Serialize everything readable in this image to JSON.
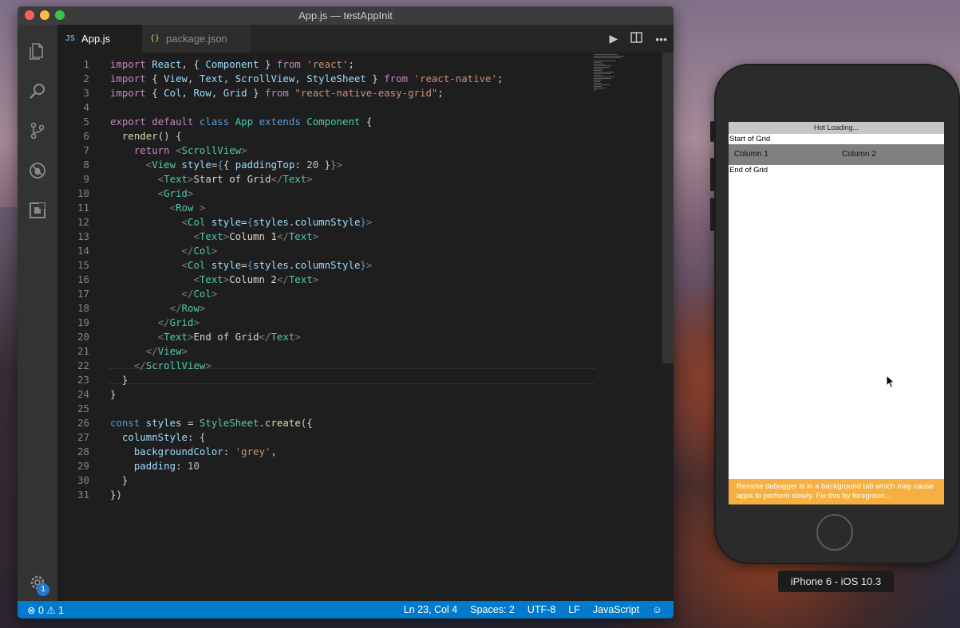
{
  "window": {
    "title": "App.js — testAppInit"
  },
  "tabs": [
    {
      "icon": "JS",
      "label": "App.js",
      "active": true,
      "close": "×"
    },
    {
      "icon": "{}",
      "label": "package.json",
      "active": false
    }
  ],
  "code_lines": [
    {
      "n": "1",
      "tokens": [
        [
          "k",
          "import"
        ],
        [
          "p",
          " "
        ],
        [
          "v",
          "React"
        ],
        [
          "p",
          ", { "
        ],
        [
          "v",
          "Component"
        ],
        [
          "p",
          " } "
        ],
        [
          "k",
          "from"
        ],
        [
          "p",
          " "
        ],
        [
          "s",
          "'react'"
        ],
        [
          "p",
          ";"
        ]
      ]
    },
    {
      "n": "2",
      "tokens": [
        [
          "k",
          "import"
        ],
        [
          "p",
          " { "
        ],
        [
          "v",
          "View"
        ],
        [
          "p",
          ", "
        ],
        [
          "v",
          "Text"
        ],
        [
          "p",
          ", "
        ],
        [
          "v",
          "ScrollView"
        ],
        [
          "p",
          ", "
        ],
        [
          "v",
          "StyleSheet"
        ],
        [
          "p",
          " } "
        ],
        [
          "k",
          "from"
        ],
        [
          "p",
          " "
        ],
        [
          "s",
          "'react-native'"
        ],
        [
          "p",
          ";"
        ]
      ]
    },
    {
      "n": "3",
      "tokens": [
        [
          "k",
          "import"
        ],
        [
          "p",
          " { "
        ],
        [
          "v",
          "Col"
        ],
        [
          "p",
          ", "
        ],
        [
          "v",
          "Row"
        ],
        [
          "p",
          ", "
        ],
        [
          "v",
          "Grid"
        ],
        [
          "p",
          " } "
        ],
        [
          "k",
          "from"
        ],
        [
          "p",
          " "
        ],
        [
          "s",
          "\"react-native-easy-grid\""
        ],
        [
          "p",
          ";"
        ]
      ]
    },
    {
      "n": "4",
      "tokens": []
    },
    {
      "n": "5",
      "tokens": [
        [
          "k",
          "export"
        ],
        [
          "p",
          " "
        ],
        [
          "k",
          "default"
        ],
        [
          "p",
          " "
        ],
        [
          "kb",
          "class"
        ],
        [
          "p",
          " "
        ],
        [
          "c",
          "App"
        ],
        [
          "p",
          " "
        ],
        [
          "kb",
          "extends"
        ],
        [
          "p",
          " "
        ],
        [
          "c",
          "Component"
        ],
        [
          "p",
          " {"
        ]
      ]
    },
    {
      "n": "6",
      "tokens": [
        [
          "p",
          "  "
        ],
        [
          "f",
          "render"
        ],
        [
          "p",
          "() {"
        ]
      ]
    },
    {
      "n": "7",
      "tokens": [
        [
          "p",
          "    "
        ],
        [
          "k",
          "return"
        ],
        [
          "p",
          " "
        ],
        [
          "tg",
          "<"
        ],
        [
          "c",
          "ScrollView"
        ],
        [
          "tg",
          ">"
        ]
      ]
    },
    {
      "n": "8",
      "tokens": [
        [
          "p",
          "      "
        ],
        [
          "tg",
          "<"
        ],
        [
          "c",
          "View"
        ],
        [
          "p",
          " "
        ],
        [
          "v",
          "style"
        ],
        [
          "p",
          "="
        ],
        [
          "kb",
          "{"
        ],
        [
          "p",
          "{ "
        ],
        [
          "v",
          "paddingTop"
        ],
        [
          "p",
          ": "
        ],
        [
          "n",
          "20"
        ],
        [
          "p",
          " }"
        ],
        [
          "kb",
          "}"
        ],
        [
          "tg",
          ">"
        ]
      ]
    },
    {
      "n": "9",
      "tokens": [
        [
          "p",
          "        "
        ],
        [
          "tg",
          "<"
        ],
        [
          "c",
          "Text"
        ],
        [
          "tg",
          ">"
        ],
        [
          "p",
          "Start of Grid"
        ],
        [
          "tg",
          "</"
        ],
        [
          "c",
          "Text"
        ],
        [
          "tg",
          ">"
        ]
      ]
    },
    {
      "n": "10",
      "tokens": [
        [
          "p",
          "        "
        ],
        [
          "tg",
          "<"
        ],
        [
          "c",
          "Grid"
        ],
        [
          "tg",
          ">"
        ]
      ]
    },
    {
      "n": "11",
      "tokens": [
        [
          "p",
          "          "
        ],
        [
          "tg",
          "<"
        ],
        [
          "c",
          "Row"
        ],
        [
          "p",
          " "
        ],
        [
          "tg",
          ">"
        ]
      ]
    },
    {
      "n": "12",
      "tokens": [
        [
          "p",
          "            "
        ],
        [
          "tg",
          "<"
        ],
        [
          "c",
          "Col"
        ],
        [
          "p",
          " "
        ],
        [
          "v",
          "style"
        ],
        [
          "p",
          "="
        ],
        [
          "kb",
          "{"
        ],
        [
          "v",
          "styles"
        ],
        [
          "p",
          "."
        ],
        [
          "v",
          "columnStyle"
        ],
        [
          "kb",
          "}"
        ],
        [
          "tg",
          ">"
        ]
      ]
    },
    {
      "n": "13",
      "tokens": [
        [
          "p",
          "              "
        ],
        [
          "tg",
          "<"
        ],
        [
          "c",
          "Text"
        ],
        [
          "tg",
          ">"
        ],
        [
          "p",
          "Column 1"
        ],
        [
          "tg",
          "</"
        ],
        [
          "c",
          "Text"
        ],
        [
          "tg",
          ">"
        ]
      ]
    },
    {
      "n": "14",
      "tokens": [
        [
          "p",
          "            "
        ],
        [
          "tg",
          "</"
        ],
        [
          "c",
          "Col"
        ],
        [
          "tg",
          ">"
        ]
      ]
    },
    {
      "n": "15",
      "tokens": [
        [
          "p",
          "            "
        ],
        [
          "tg",
          "<"
        ],
        [
          "c",
          "Col"
        ],
        [
          "p",
          " "
        ],
        [
          "v",
          "style"
        ],
        [
          "p",
          "="
        ],
        [
          "kb",
          "{"
        ],
        [
          "v",
          "styles"
        ],
        [
          "p",
          "."
        ],
        [
          "v",
          "columnStyle"
        ],
        [
          "kb",
          "}"
        ],
        [
          "tg",
          ">"
        ]
      ]
    },
    {
      "n": "16",
      "tokens": [
        [
          "p",
          "              "
        ],
        [
          "tg",
          "<"
        ],
        [
          "c",
          "Text"
        ],
        [
          "tg",
          ">"
        ],
        [
          "p",
          "Column 2"
        ],
        [
          "tg",
          "</"
        ],
        [
          "c",
          "Text"
        ],
        [
          "tg",
          ">"
        ]
      ]
    },
    {
      "n": "17",
      "tokens": [
        [
          "p",
          "            "
        ],
        [
          "tg",
          "</"
        ],
        [
          "c",
          "Col"
        ],
        [
          "tg",
          ">"
        ]
      ]
    },
    {
      "n": "18",
      "tokens": [
        [
          "p",
          "          "
        ],
        [
          "tg",
          "</"
        ],
        [
          "c",
          "Row"
        ],
        [
          "tg",
          ">"
        ]
      ]
    },
    {
      "n": "19",
      "tokens": [
        [
          "p",
          "        "
        ],
        [
          "tg",
          "</"
        ],
        [
          "c",
          "Grid"
        ],
        [
          "tg",
          ">"
        ]
      ]
    },
    {
      "n": "20",
      "tokens": [
        [
          "p",
          "        "
        ],
        [
          "tg",
          "<"
        ],
        [
          "c",
          "Text"
        ],
        [
          "tg",
          ">"
        ],
        [
          "p",
          "End of Grid"
        ],
        [
          "tg",
          "</"
        ],
        [
          "c",
          "Text"
        ],
        [
          "tg",
          ">"
        ]
      ]
    },
    {
      "n": "21",
      "tokens": [
        [
          "p",
          "      "
        ],
        [
          "tg",
          "</"
        ],
        [
          "c",
          "View"
        ],
        [
          "tg",
          ">"
        ]
      ]
    },
    {
      "n": "22",
      "tokens": [
        [
          "p",
          "    "
        ],
        [
          "tg",
          "</"
        ],
        [
          "c",
          "ScrollView"
        ],
        [
          "tg",
          ">"
        ]
      ]
    },
    {
      "n": "23",
      "tokens": [
        [
          "p",
          "  }"
        ]
      ]
    },
    {
      "n": "24",
      "tokens": [
        [
          "p",
          "}"
        ]
      ]
    },
    {
      "n": "25",
      "tokens": []
    },
    {
      "n": "26",
      "tokens": [
        [
          "kb",
          "const"
        ],
        [
          "p",
          " "
        ],
        [
          "v",
          "styles"
        ],
        [
          "p",
          " = "
        ],
        [
          "c",
          "StyleSheet"
        ],
        [
          "p",
          "."
        ],
        [
          "f",
          "create"
        ],
        [
          "p",
          "({"
        ]
      ]
    },
    {
      "n": "27",
      "tokens": [
        [
          "p",
          "  "
        ],
        [
          "v",
          "columnStyle"
        ],
        [
          "p",
          ": {"
        ]
      ]
    },
    {
      "n": "28",
      "tokens": [
        [
          "p",
          "    "
        ],
        [
          "v",
          "backgroundColor"
        ],
        [
          "p",
          ": "
        ],
        [
          "s",
          "'grey'"
        ],
        [
          "p",
          ","
        ]
      ]
    },
    {
      "n": "29",
      "tokens": [
        [
          "p",
          "    "
        ],
        [
          "v",
          "padding"
        ],
        [
          "p",
          ": "
        ],
        [
          "n",
          "10"
        ]
      ]
    },
    {
      "n": "30",
      "tokens": [
        [
          "p",
          "  }"
        ]
      ]
    },
    {
      "n": "31",
      "tokens": [
        [
          "p",
          "})"
        ]
      ]
    }
  ],
  "cursor": {
    "line": 23
  },
  "statusbar": {
    "errors": "0",
    "warnings": "1",
    "position": "Ln 23, Col 4",
    "spaces": "Spaces: 2",
    "encoding": "UTF-8",
    "eol": "LF",
    "language": "JavaScript",
    "feedback_icon": "smiley-icon"
  },
  "activity_bar": {
    "icons": [
      "files-icon",
      "search-icon",
      "source-control-icon",
      "debug-icon",
      "extensions-icon",
      "gear-icon"
    ],
    "settings_badge": "1"
  },
  "simulator": {
    "hot_loading": "Hot Loading...",
    "start_text": "Start of Grid",
    "columns": [
      "Column 1",
      "Column 2"
    ],
    "end_text": "End of Grid",
    "debug_banner": "Remote debugger is in a background tab which may cause apps to perform slowly. Fix this by foregroun...",
    "device_label": "iPhone 6 - iOS 10.3"
  },
  "colors": {
    "statusbar": "#007acc",
    "editor_bg": "#1e1e1e",
    "banner": "#f5b041",
    "grid_bg": "#808080"
  }
}
